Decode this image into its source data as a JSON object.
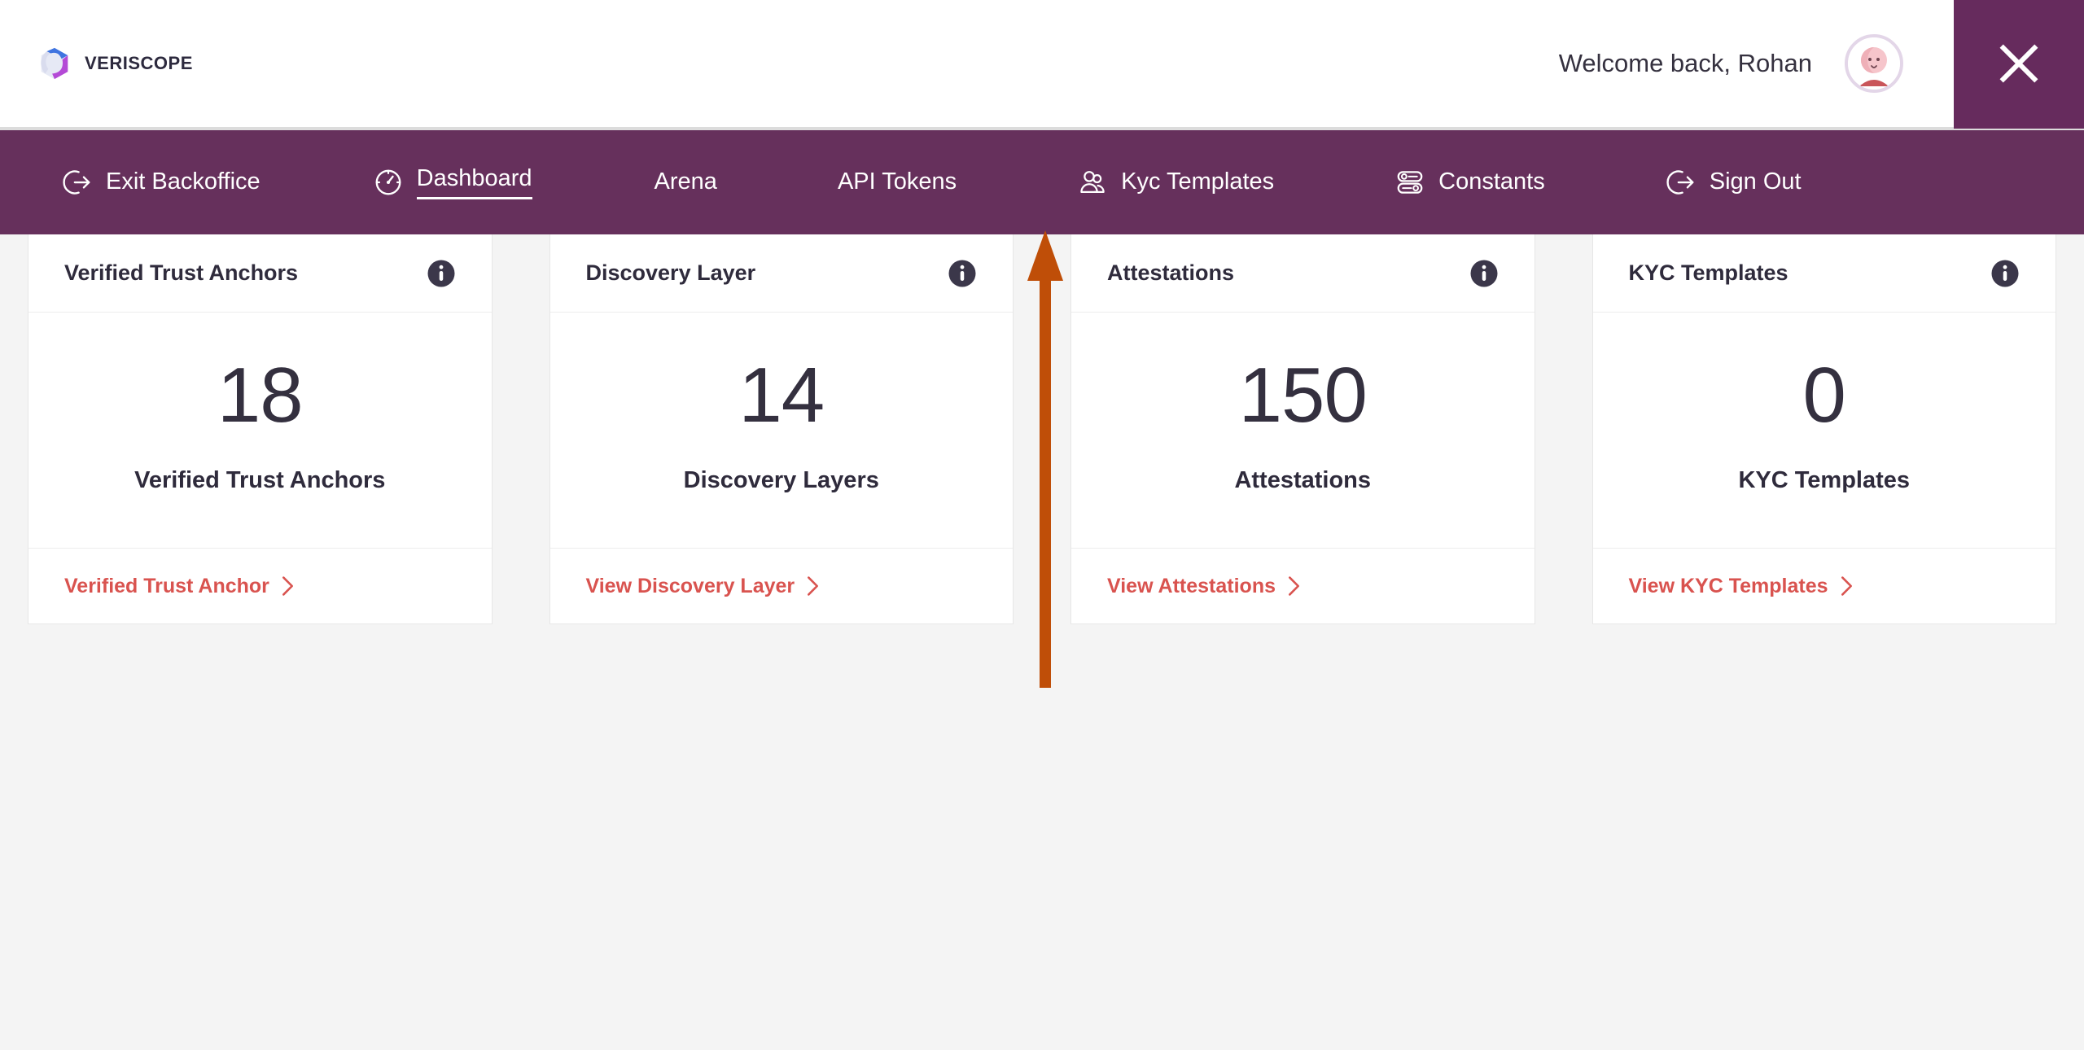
{
  "header": {
    "brand_name": "VERISCOPE",
    "brand_logo_icon": "veriscope-swirl-logo",
    "welcome_text": "Welcome back, Rohan",
    "avatar_icon": "user-avatar",
    "close_icon": "close-icon"
  },
  "nav": {
    "items": [
      {
        "label": "Exit Backoffice",
        "icon": "logout-icon",
        "active": false,
        "has_icon": true
      },
      {
        "label": "Dashboard",
        "icon": "speedometer-icon",
        "active": true,
        "has_icon": true
      },
      {
        "label": "Arena",
        "icon": "",
        "active": false,
        "has_icon": false
      },
      {
        "label": "API Tokens",
        "icon": "",
        "active": false,
        "has_icon": false
      },
      {
        "label": "Kyc Templates",
        "icon": "users-icon",
        "active": false,
        "has_icon": true
      },
      {
        "label": "Constants",
        "icon": "sliders-icon",
        "active": false,
        "has_icon": true
      },
      {
        "label": "Sign Out",
        "icon": "logout-icon",
        "active": false,
        "has_icon": true
      }
    ]
  },
  "cards": [
    {
      "title": "Verified Trust Anchors",
      "info_icon": "info-icon",
      "value": "18",
      "sublabel": "Verified Trust Anchors",
      "link_label": "Verified Trust Anchor",
      "link_icon": "chevron-right-icon"
    },
    {
      "title": "Discovery Layer",
      "info_icon": "info-icon",
      "value": "14",
      "sublabel": "Discovery Layers",
      "link_label": "View Discovery Layer",
      "link_icon": "chevron-right-icon"
    },
    {
      "title": "Attestations",
      "info_icon": "info-icon",
      "value": "150",
      "sublabel": "Attestations",
      "link_label": "View Attestations",
      "link_icon": "chevron-right-icon"
    },
    {
      "title": "KYC Templates",
      "info_icon": "info-icon",
      "value": "0",
      "sublabel": "KYC Templates",
      "link_label": "View KYC Templates",
      "link_icon": "chevron-right-icon"
    }
  ],
  "annotation": {
    "arrow_icon": "up-arrow-annotation",
    "points_to": "API Tokens",
    "color": "#bf4e08"
  },
  "colors": {
    "nav_background": "#66305c",
    "page_background": "#f4f4f4",
    "card_background": "#ffffff",
    "link_red": "#d9534f",
    "text_dark": "#2f2b3c",
    "annotation_orange": "#bf4e08"
  }
}
